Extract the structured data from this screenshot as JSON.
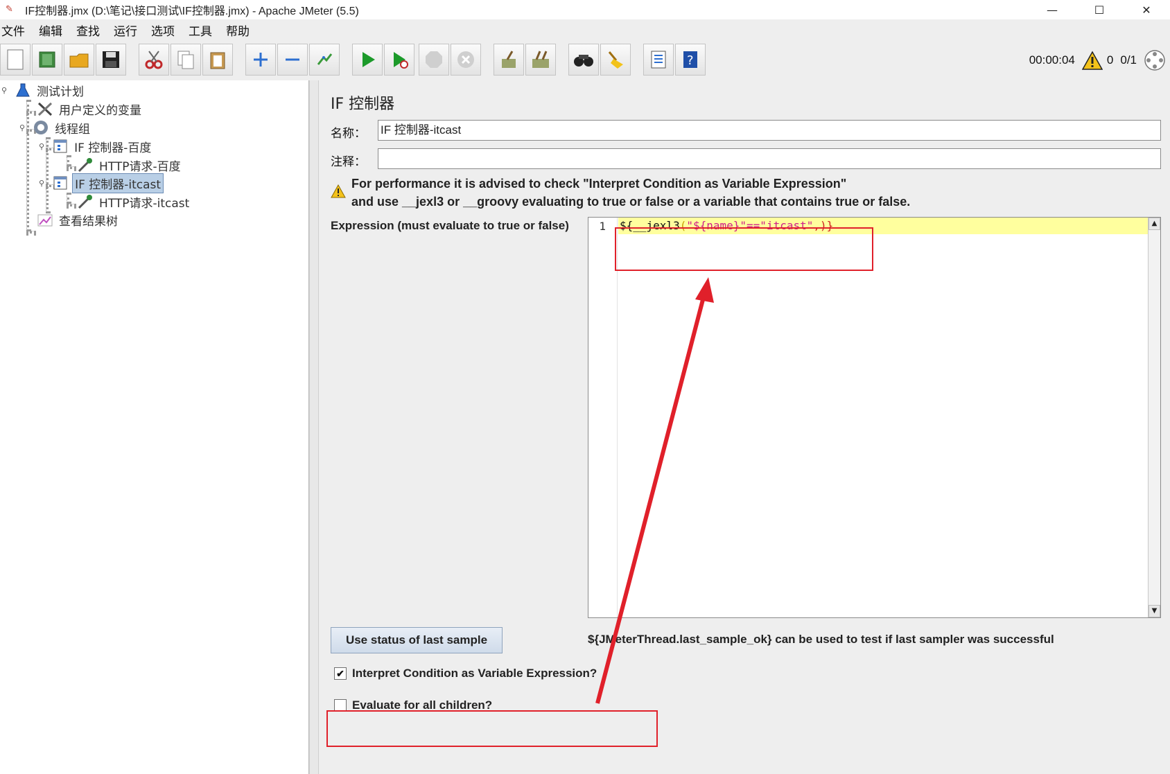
{
  "window": {
    "title": "IF控制器.jmx (D:\\笔记\\接口测试\\IF控制器.jmx) - Apache JMeter (5.5)",
    "minimize": "—",
    "maximize": "☐",
    "close": "✕"
  },
  "menu": [
    "文件",
    "编辑",
    "查找",
    "运行",
    "选项",
    "工具",
    "帮助"
  ],
  "toolbar": {
    "timer": "00:00:04",
    "warning_count": "0",
    "thread_count": "0/1",
    "icons": [
      "new-icon",
      "templates-icon",
      "open-icon",
      "save-icon",
      "cut-icon",
      "copy-icon",
      "paste-icon",
      "expand-icon",
      "collapse-icon",
      "toggle-icon",
      "start-icon",
      "start-no-pause-icon",
      "stop-icon",
      "shutdown-icon",
      "clear-icon",
      "clear-all-icon",
      "search-icon",
      "reset-search-icon",
      "function-helper-icon",
      "help-icon"
    ]
  },
  "tree": {
    "nodes": [
      {
        "label": "测试计划"
      },
      {
        "label": "用户定义的变量"
      },
      {
        "label": "线程组"
      },
      {
        "label": "IF 控制器-百度"
      },
      {
        "label": "HTTP请求-百度"
      },
      {
        "label": "IF 控制器-itcast"
      },
      {
        "label": "HTTP请求-itcast"
      },
      {
        "label": "查看结果树"
      }
    ]
  },
  "panel": {
    "title": "IF 控制器",
    "name_label": "名称：",
    "name_value": "IF 控制器-itcast",
    "comment_label": "注释：",
    "comment_value": "",
    "warning_line1": "For performance it is advised to check \"Interpret Condition as Variable Expression\"",
    "warning_line2": "and use __jexl3 or __groovy evaluating to true or false or a variable that contains true or false.",
    "expression_label": "Expression (must evaluate to true or false)",
    "line_number": "1",
    "code": {
      "part1": "${",
      "part2": "__jexl3",
      "part3": "(",
      "part4": "\"${name}\"==\"itcast\"",
      "part5": ",)}"
    },
    "use_status_button": "Use status of last sample",
    "hint": "${JMeterThread.last_sample_ok} can be used to test if last sampler was successful",
    "interpret_checkbox": "Interpret Condition as Variable Expression?",
    "interpret_checked": true,
    "evaluate_checkbox": "Evaluate for all children?",
    "evaluate_checked": false
  },
  "colors": {
    "annotation": "#e0202a",
    "highlight_line": "#ffff9e",
    "selected_node": "#b9cfe6"
  }
}
